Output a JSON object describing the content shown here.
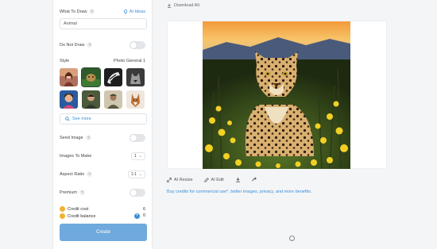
{
  "left_panel": {
    "what_to_draw_label": "What To Draw",
    "help_glyph": "?",
    "ai_ideas_label": "AI Ideas",
    "prompt_value": "Animal",
    "do_not_draw_label": "Do Not Draw",
    "style_label": "Style",
    "style_selected": "Photo General 1",
    "style_thumbs": [
      "portrait-woman",
      "jungle-animal",
      "zebra",
      "wolf-mono",
      "smiling-girl",
      "portrait-man",
      "soldier",
      "fox-illustration"
    ],
    "see_more_label": "See more",
    "seed_image_label": "Seed Image",
    "images_to_make_label": "Images To Make",
    "images_to_make_value": "1",
    "aspect_ratio_label": "Aspect Ratio",
    "aspect_ratio_value": "1:1",
    "premium_label": "Premium",
    "credit_cost_label": "Credit cost",
    "credit_cost_value": "6",
    "credit_balance_label": "Credit balance",
    "credit_balance_value": "0",
    "create_label": "Create"
  },
  "main": {
    "download_all_label": "Download All",
    "tools": {
      "ai_resize_label": "AI Resize",
      "ai_edit_label": "AI Edit"
    },
    "promo_text": "Buy credits for commercial use*, better images, privacy, and more benefits."
  },
  "colors": {
    "accent": "#3a8fd6",
    "create_button": "#6fa9de",
    "coin": "#f2b233"
  }
}
